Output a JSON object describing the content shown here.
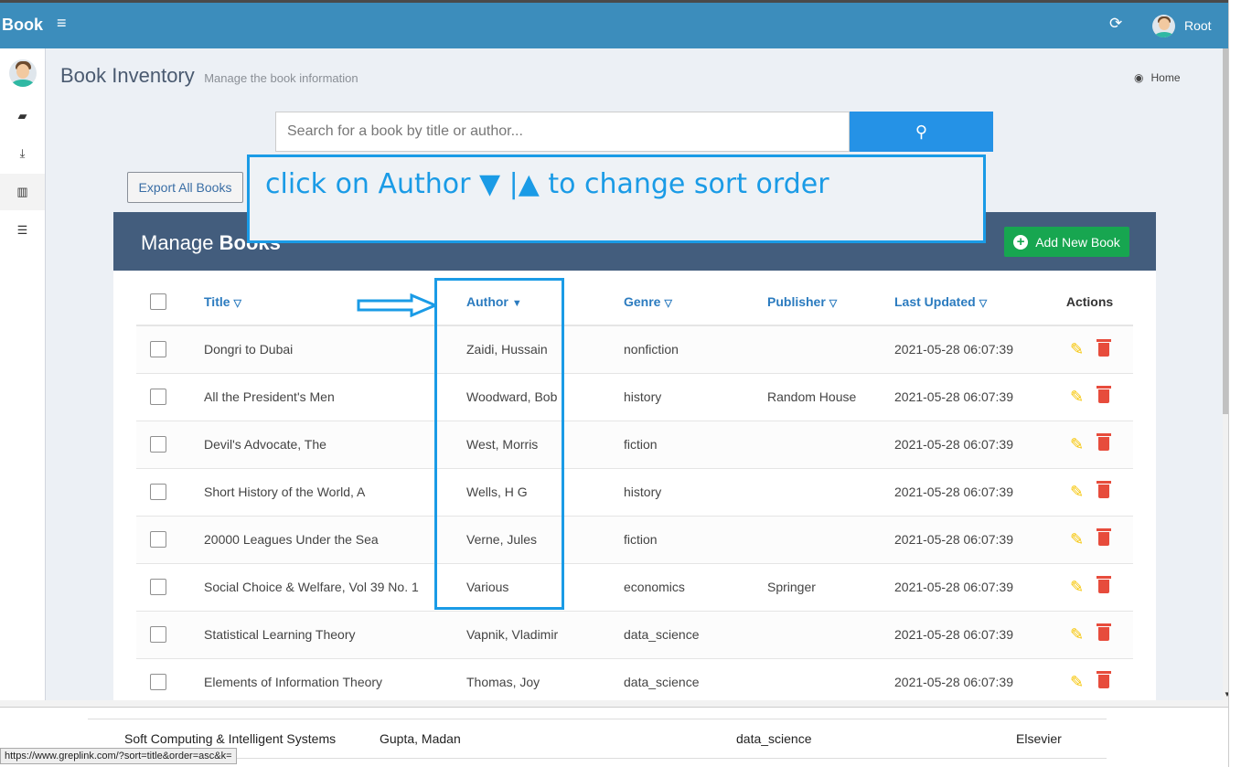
{
  "topbar": {
    "brand": "Book",
    "menu_icon": "bars-icon",
    "refresh_icon": "refresh-icon",
    "user_name": "Root"
  },
  "sidebar": {
    "items": [
      {
        "icon": "book-icon",
        "glyph": "📕"
      },
      {
        "icon": "download-icon",
        "glyph": "⤓"
      },
      {
        "icon": "bar-chart-icon",
        "glyph": "📊"
      },
      {
        "icon": "list-icon",
        "glyph": "☰"
      }
    ]
  },
  "page": {
    "title": "Book Inventory",
    "subtitle": "Manage the book information",
    "breadcrumb": "Home"
  },
  "search": {
    "placeholder": "Search for a book by title or author...",
    "value": ""
  },
  "export_label": "Export All Books",
  "panel": {
    "title_light": "Manage ",
    "title_bold": "Books",
    "add_label": "Add New Book"
  },
  "table": {
    "columns": {
      "title": {
        "label": "Title",
        "sort": "▽"
      },
      "author": {
        "label": "Author",
        "sort": "▼"
      },
      "genre": {
        "label": "Genre",
        "sort": "▽"
      },
      "publisher": {
        "label": "Publisher",
        "sort": "▽"
      },
      "updated": {
        "label": "Last Updated",
        "sort": "▽"
      },
      "actions": {
        "label": "Actions"
      }
    },
    "rows": [
      {
        "title": "Dongri to Dubai",
        "author": "Zaidi, Hussain",
        "genre": "nonfiction",
        "publisher": "",
        "updated": "2021-05-28 06:07:39"
      },
      {
        "title": "All the President's Men",
        "author": "Woodward, Bob",
        "genre": "history",
        "publisher": "Random House",
        "updated": "2021-05-28 06:07:39"
      },
      {
        "title": "Devil's Advocate, The",
        "author": "West, Morris",
        "genre": "fiction",
        "publisher": "",
        "updated": "2021-05-28 06:07:39"
      },
      {
        "title": "Short History of the World, A",
        "author": "Wells, H G",
        "genre": "history",
        "publisher": "",
        "updated": "2021-05-28 06:07:39"
      },
      {
        "title": "20000 Leagues Under the Sea",
        "author": "Verne, Jules",
        "genre": "fiction",
        "publisher": "",
        "updated": "2021-05-28 06:07:39"
      },
      {
        "title": "Social Choice & Welfare, Vol 39 No. 1",
        "author": "Various",
        "genre": "economics",
        "publisher": "Springer",
        "updated": "2021-05-28 06:07:39"
      },
      {
        "title": "Statistical Learning Theory",
        "author": "Vapnik, Vladimir",
        "genre": "data_science",
        "publisher": "",
        "updated": "2021-05-28 06:07:39"
      },
      {
        "title": "Elements of Information Theory",
        "author": "Thomas, Joy",
        "genre": "data_science",
        "publisher": "",
        "updated": "2021-05-28 06:07:39"
      }
    ]
  },
  "annotation": {
    "text": "click on Author ▼  |▲   to change sort order"
  },
  "background_page": {
    "row": {
      "title": "Soft Computing & Intelligent Systems",
      "author": "Gupta, Madan",
      "genre": "data_science",
      "publisher": "Elsevier"
    },
    "status_url": "https://www.greplink.com/?sort=title&order=asc&k="
  },
  "colors": {
    "header": "#3c8dbc",
    "panel_header": "#435d7d",
    "add_button": "#17a650",
    "search_button": "#2592e6",
    "annotation": "#1a9be6",
    "edit": "#f6c400",
    "delete": "#e74c3c"
  }
}
